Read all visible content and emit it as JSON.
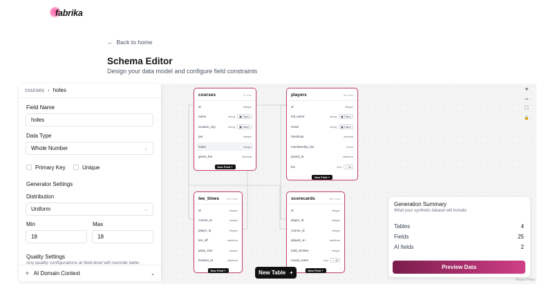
{
  "brand": {
    "name": "fabrika"
  },
  "header": {
    "back_label": "Back to home",
    "title": "Schema Editor",
    "subtitle": "Design your data model and configure field constraints"
  },
  "panel": {
    "breadcrumb": [
      "courses",
      "holes"
    ],
    "field_name_label": "Field Name",
    "field_name_value": "holes",
    "data_type_label": "Data Type",
    "data_type_value": "Whole Number",
    "primary_key_label": "Primary Key",
    "unique_label": "Unique",
    "generator_settings_label": "Generator Settings",
    "distribution_label": "Distribution",
    "distribution_value": "Uniform",
    "min_label": "Min",
    "min_value": "18",
    "max_label": "Max",
    "max_value": "18",
    "quality_label": "Quality Settings",
    "quality_note": "Any quality configurations at field-level will override table-",
    "ai_context_label": "AI Domain Context"
  },
  "tables": [
    {
      "name": "courses",
      "rows": "8 rows",
      "new_field": "New Field +",
      "fields": [
        {
          "name": "id",
          "type": "integer",
          "badge": ""
        },
        {
          "name": "name",
          "type": "string",
          "badge": "Faker"
        },
        {
          "name": "location_city",
          "type": "string",
          "badge": "Faker"
        },
        {
          "name": "par",
          "type": "integer",
          "badge": ""
        },
        {
          "name": "holes",
          "type": "integer",
          "badge": ""
        },
        {
          "name": "green_fee",
          "type": "decimal",
          "badge": ""
        }
      ]
    },
    {
      "name": "players",
      "rows": "50 rows",
      "new_field": "New Field +",
      "fields": [
        {
          "name": "id",
          "type": "integer",
          "badge": ""
        },
        {
          "name": "full_name",
          "type": "string",
          "badge": "Faker"
        },
        {
          "name": "email",
          "type": "string",
          "badge": "Faker"
        },
        {
          "name": "handicap",
          "type": "decimal",
          "badge": ""
        },
        {
          "name": "membership_tier",
          "type": "enum",
          "badge": ""
        },
        {
          "name": "joined_at",
          "type": "datetime",
          "badge": ""
        },
        {
          "name": "bio",
          "type": "text",
          "badge": "AI"
        }
      ]
    },
    {
      "name": "tee_times",
      "rows": "120 rows",
      "new_field": "New Field +",
      "fields": [
        {
          "name": "id",
          "type": "integer",
          "badge": ""
        },
        {
          "name": "course_id",
          "type": "integer",
          "badge": ""
        },
        {
          "name": "player_id",
          "type": "integer",
          "badge": ""
        },
        {
          "name": "tee_off",
          "type": "datetime",
          "badge": ""
        },
        {
          "name": "party_size",
          "type": "integer",
          "badge": ""
        },
        {
          "name": "booked_at",
          "type": "datetime",
          "badge": ""
        }
      ]
    },
    {
      "name": "scorecards",
      "rows": "180 rows",
      "new_field": "New Field +",
      "fields": [
        {
          "name": "id",
          "type": "integer",
          "badge": ""
        },
        {
          "name": "player_id",
          "type": "integer",
          "badge": ""
        },
        {
          "name": "course_id",
          "type": "integer",
          "badge": ""
        },
        {
          "name": "played_on",
          "type": "datetime",
          "badge": ""
        },
        {
          "name": "total_strokes",
          "type": "integer",
          "badge": ""
        },
        {
          "name": "round_notes",
          "type": "text",
          "badge": "AI"
        }
      ]
    }
  ],
  "canvas_controls": {
    "zoom_in": "+",
    "zoom_out": "−",
    "fit": "⛶",
    "lock": "🔒"
  },
  "new_table_label": "New Table",
  "summary": {
    "title": "Generation Summary",
    "subtitle": "What your synthetic dataset will include",
    "rows": [
      {
        "label": "Tables",
        "value": "4"
      },
      {
        "label": "Fields",
        "value": "25"
      },
      {
        "label": "AI fields",
        "value": "2"
      }
    ],
    "preview_label": "Preview Data"
  },
  "attribution": "React Flow",
  "colors": {
    "accent": "#c2486e",
    "button_dark": "#111111",
    "preview_from": "#7a1d4c",
    "preview_to": "#d03f87"
  }
}
